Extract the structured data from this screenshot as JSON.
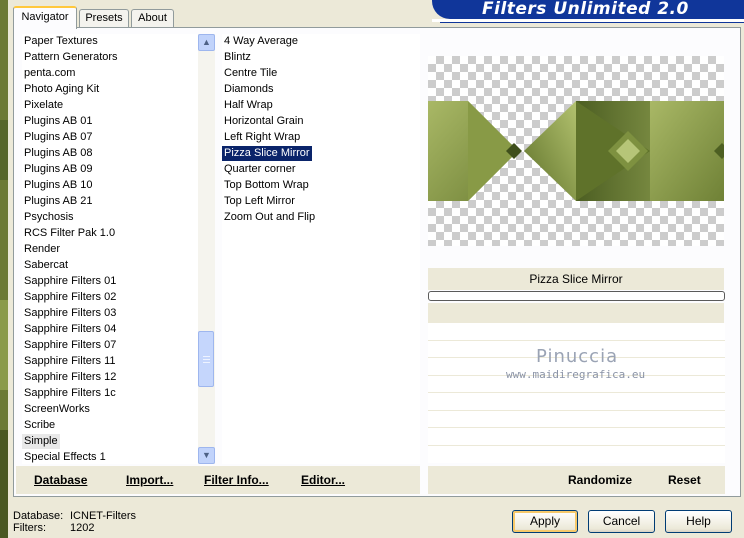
{
  "title": "Filters Unlimited 2.0",
  "tabs": [
    {
      "label": "Navigator",
      "active": true
    },
    {
      "label": "Presets",
      "active": false
    },
    {
      "label": "About",
      "active": false
    }
  ],
  "categories": [
    "Paper Textures",
    "Pattern Generators",
    "penta.com",
    "Photo Aging Kit",
    "Pixelate",
    "Plugins AB 01",
    "Plugins AB 07",
    "Plugins AB 08",
    "Plugins AB 09",
    "Plugins AB 10",
    "Plugins AB 21",
    "Psychosis",
    "RCS Filter Pak 1.0",
    "Render",
    "Sabercat",
    "Sapphire Filters 01",
    "Sapphire Filters 02",
    "Sapphire Filters 03",
    "Sapphire Filters 04",
    "Sapphire Filters 07",
    "Sapphire Filters 11",
    "Sapphire Filters 12",
    "Sapphire Filters 1c",
    "ScreenWorks",
    "Scribe",
    "Simple",
    "Special Effects 1"
  ],
  "categories_highlighted": "Simple",
  "filters": [
    "4 Way Average",
    "Blintz",
    "Centre Tile",
    "Diamonds",
    "Half Wrap",
    "Horizontal Grain",
    "Left Right Wrap",
    "Pizza Slice Mirror",
    "Quarter corner",
    "Top Bottom Wrap",
    "Top Left Mirror",
    "Zoom Out and Flip"
  ],
  "filters_selected": "Pizza Slice Mirror",
  "left_buttons": {
    "database": {
      "u": "D",
      "rest": "atabase"
    },
    "import": {
      "u": "I",
      "rest": "mport..."
    },
    "filter_info": {
      "pre": "Filter ",
      "u": "I",
      "rest": "nfo..."
    },
    "editor": {
      "u": "E",
      "rest": "ditor..."
    }
  },
  "right_buttons": {
    "randomize": "Randomize",
    "reset": "Reset"
  },
  "current_filter_name": "Pizza Slice Mirror",
  "watermark": {
    "name": "Pinuccia",
    "url": "www.maidiregrafica.eu"
  },
  "info": {
    "database_label": "Database:",
    "database_value": "ICNET-Filters",
    "filters_label": "Filters:",
    "filters_value": "1202"
  },
  "dialog_buttons": {
    "apply": "Apply",
    "cancel": "Cancel",
    "help": "Help"
  },
  "colors": {
    "title_bar": "#10369a",
    "selection": "#0a246a",
    "preview_green": "#8a9b4a"
  },
  "icons": {
    "scroll_up": "chevron-up-icon",
    "scroll_down": "chevron-down-icon"
  }
}
